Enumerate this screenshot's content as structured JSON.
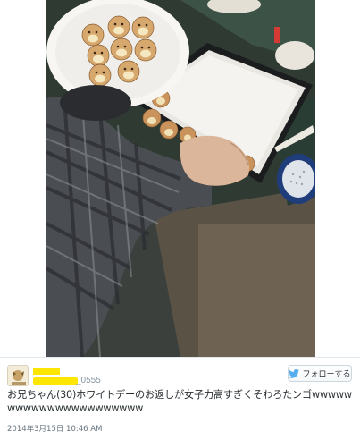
{
  "tweet": {
    "display_name": "",
    "screen_name": "@",
    "screen_name_tail": "_0555",
    "follow_label": "フォローする",
    "text": "お兄ちゃん(30)ホワイトデーのお返しが女子力高すぎくそわろたンゴwwwwwwwwwwwwwwwwwwwwww",
    "timestamp": "2014年3月15日 10:46 AM"
  },
  "colors": {
    "twitter_blue": "#55acee",
    "redaction": "#ffe600",
    "text": "#292f33",
    "muted": "#8899a6"
  },
  "icons": {
    "follow": "twitter-bird-icon"
  }
}
